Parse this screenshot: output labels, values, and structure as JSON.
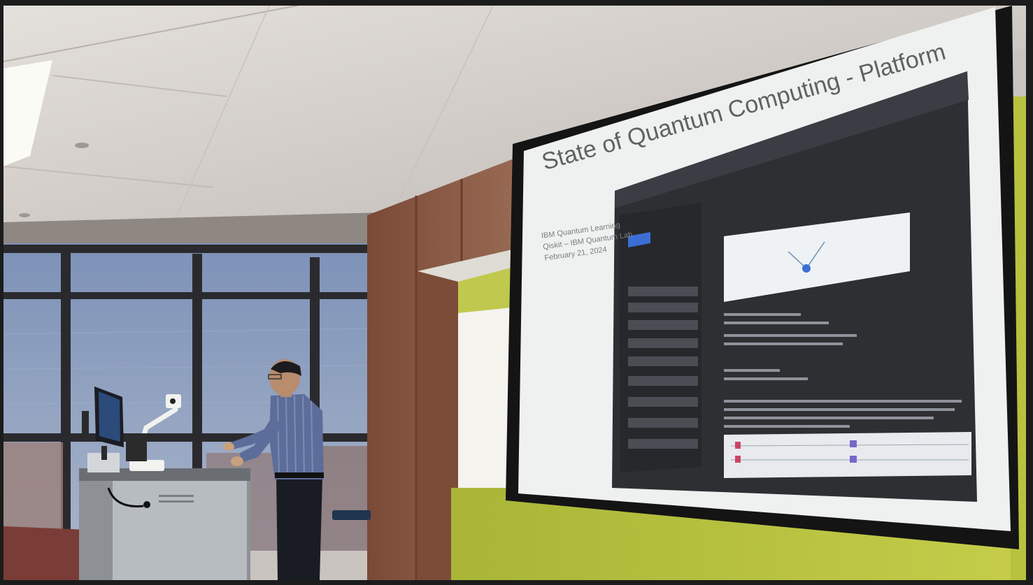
{
  "slide": {
    "title": "State of Quantum Computing - Platform",
    "subtitle_lines": [
      "IBM Quantum Learning",
      "Qiskit – IBM Quantum Lab",
      "February 21, 2024"
    ]
  },
  "colors": {
    "screen": "#eef1ef",
    "ceiling": "#d8d4d0",
    "wood_wall": "#8a5a44",
    "green_wall": "#b7c23e",
    "window_sky": "#8ea2c4",
    "embedded_ui_dark": "#2d2f33",
    "accent_blue": "#3b6fd6"
  },
  "icons": {
    "ceiling_light": "fluorescent-light-icon",
    "podium_monitor": "monitor-icon",
    "document_camera": "document-camera-icon"
  }
}
